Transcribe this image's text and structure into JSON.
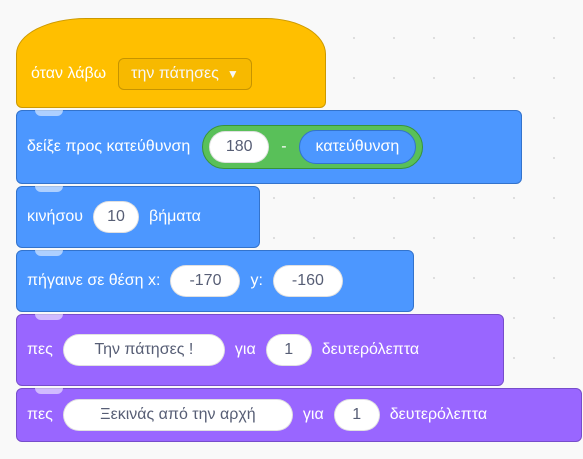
{
  "hat": {
    "label": "όταν λάβω",
    "message": "την πάτησες"
  },
  "point": {
    "label": "δείξε προς κατεύθυνση",
    "value": "180",
    "operator": "-",
    "reporter": "κατεύθυνση"
  },
  "move": {
    "label": "κινήσου",
    "steps": "10",
    "unit": "βήματα"
  },
  "goto": {
    "label": "πήγαινε σε θέση x:",
    "x": "-170",
    "ylabel": "y:",
    "y": "-160"
  },
  "say1": {
    "label": "πες",
    "text": "Την πάτησες !",
    "for": "για",
    "secs": "1",
    "unit": "δευτερόλεπτα"
  },
  "say2": {
    "label": "πες",
    "text": "Ξεκινάς από την αρχή",
    "for": "για",
    "secs": "1",
    "unit": "δευτερόλεπτα"
  },
  "colors": {
    "events": "#ffbf00",
    "motion": "#4c97ff",
    "looks": "#9966ff",
    "operators": "#59c059"
  }
}
